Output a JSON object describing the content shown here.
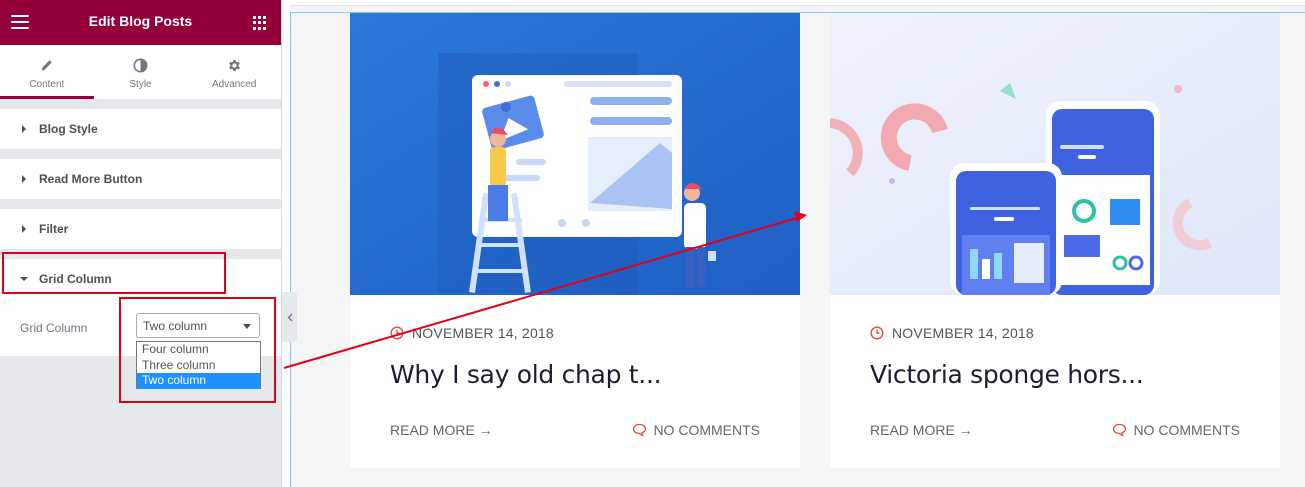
{
  "panel": {
    "title": "Edit Blog Posts",
    "header_color": "#93003c",
    "tabs": [
      {
        "label": "Content",
        "icon": "pencil-icon",
        "active": true
      },
      {
        "label": "Style",
        "icon": "contrast-icon",
        "active": false
      },
      {
        "label": "Advanced",
        "icon": "gear-icon",
        "active": false
      }
    ],
    "sections": [
      {
        "label": "Blog Style",
        "expanded": false
      },
      {
        "label": "Read More Button",
        "expanded": false
      },
      {
        "label": "Filter",
        "expanded": false
      },
      {
        "label": "Grid Column",
        "expanded": true
      }
    ],
    "grid_column": {
      "label": "Grid Column",
      "value": "Two column",
      "options": [
        "Four column",
        "Three column",
        "Two column"
      ],
      "selected_index": 2
    }
  },
  "annotation_color": "#e0001a",
  "posts": [
    {
      "date": "NOVEMBER 14, 2018",
      "title": "Why I say old chap t...",
      "read_more": "READ MORE →",
      "comments": "NO COMMENTS"
    },
    {
      "date": "NOVEMBER 14, 2018",
      "title": "Victoria sponge hors...",
      "read_more": "READ MORE →",
      "comments": "NO COMMENTS"
    }
  ],
  "accent_red": "#e14d43"
}
